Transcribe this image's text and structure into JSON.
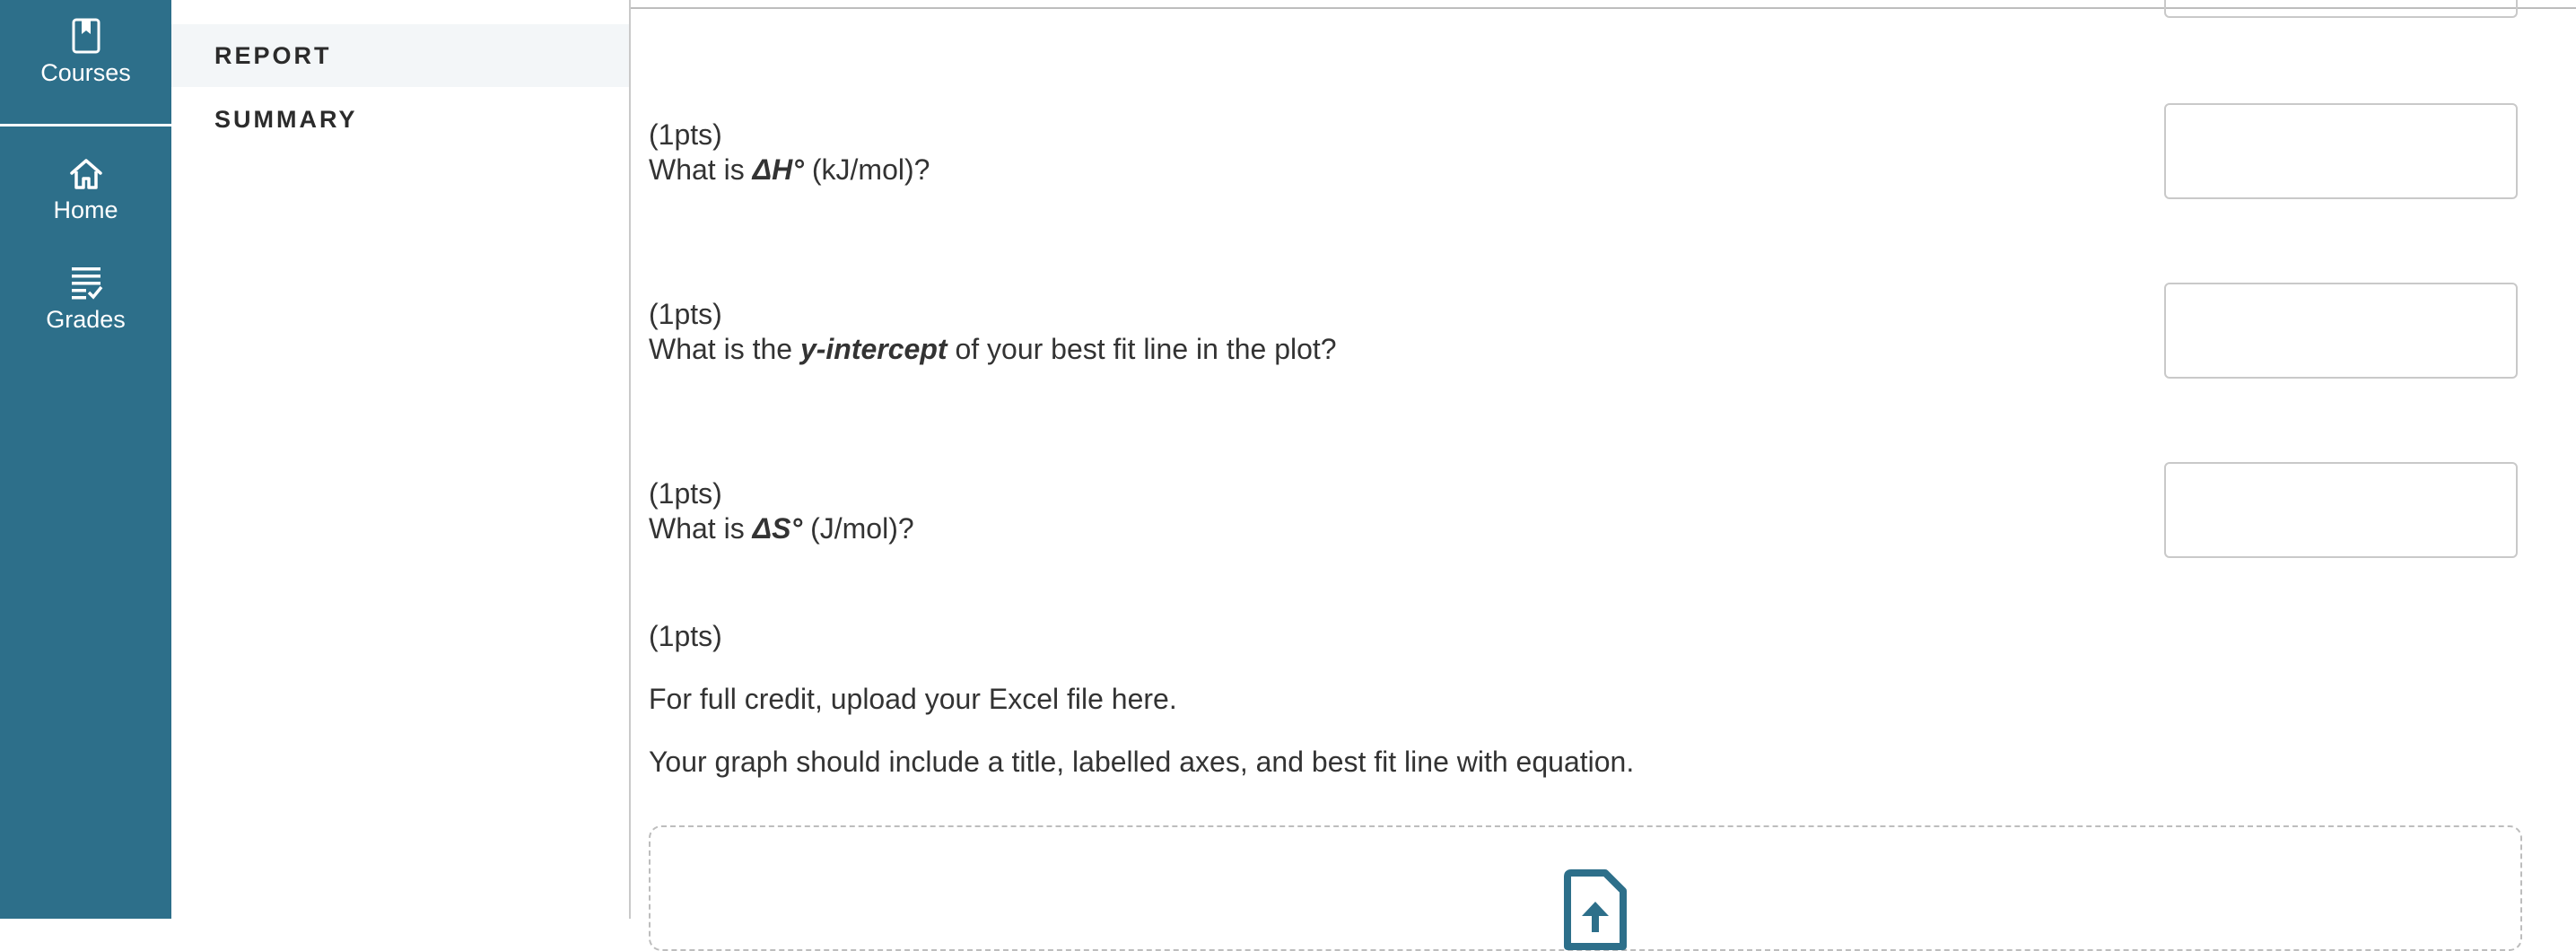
{
  "global_nav": {
    "courses_label": "Courses",
    "home_label": "Home",
    "grades_label": "Grades",
    "background_color": "#2d6f8a"
  },
  "sub_nav": {
    "items": [
      {
        "label": "REPORT",
        "active": true
      },
      {
        "label": "SUMMARY",
        "active": false
      }
    ]
  },
  "questions": [
    {
      "points": "(1pts)",
      "text_prefix": "What is ",
      "bold": "ΔH°",
      "text_suffix": " (kJ/mol)?",
      "answer": ""
    },
    {
      "points": "(1pts)",
      "text_prefix": "What is the ",
      "bold": "y-intercept",
      "text_suffix": " of your best fit line in the plot?",
      "answer": ""
    },
    {
      "points": "(1pts)",
      "text_prefix": "What is ",
      "bold": "ΔS°",
      "text_suffix": " (J/mol)?",
      "answer": ""
    }
  ],
  "upload_section": {
    "points": "(1pts)",
    "instruction_1": "For full credit, upload your Excel file here.",
    "instruction_2": "Your graph should include a title, labelled axes, and best fit line with equation.",
    "icon": "file-upload-icon"
  }
}
